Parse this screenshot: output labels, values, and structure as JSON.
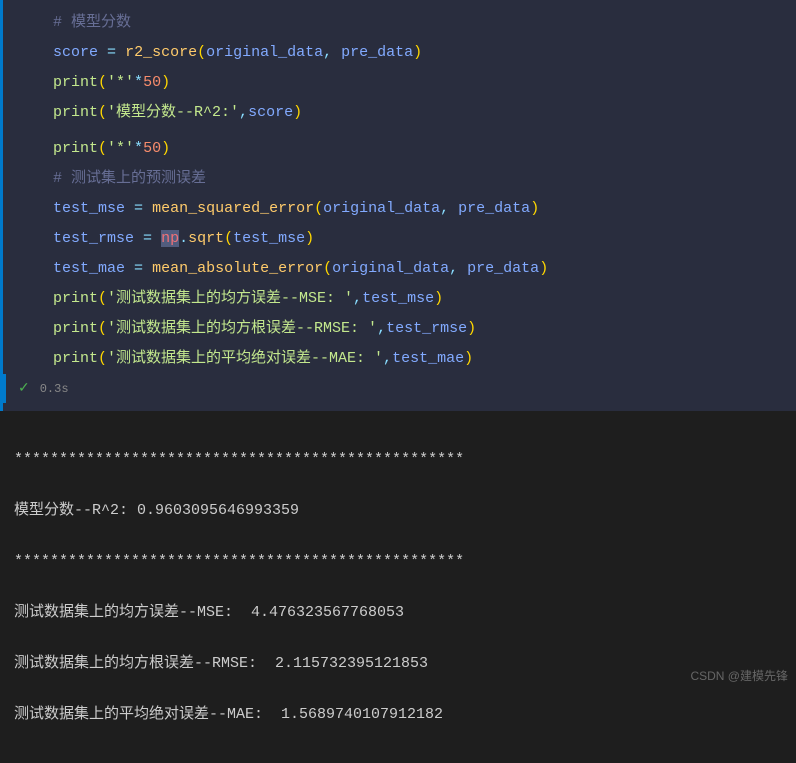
{
  "code": {
    "comment1": "# 模型分数",
    "line2_var": "score",
    "line2_func": "r2_score",
    "line2_arg1": "original_data",
    "line2_arg2": "pre_data",
    "line3_print": "print",
    "line3_str": "'*'",
    "line3_num": "50",
    "line4_print": "print",
    "line4_str": "'模型分数--R^2:'",
    "line4_arg": "score",
    "line6_print": "print",
    "line6_str": "'*'",
    "line6_num": "50",
    "comment2": "# 测试集上的预测误差",
    "line8_var": "test_mse",
    "line8_func": "mean_squared_error",
    "line8_arg1": "original_data",
    "line8_arg2": "pre_data",
    "line9_var": "test_rmse",
    "line9_mod": "np",
    "line9_func": "sqrt",
    "line9_arg": "test_mse",
    "line10_var": "test_mae",
    "line10_func": "mean_absolute_error",
    "line10_arg1": "original_data",
    "line10_arg2": "pre_data",
    "line11_print": "print",
    "line11_str": "'测试数据集上的均方误差--MSE: '",
    "line11_arg": "test_mse",
    "line12_print": "print",
    "line12_str": "'测试数据集上的均方根误差--RMSE: '",
    "line12_arg": "test_rmse",
    "line13_print": "print",
    "line13_str": "'测试数据集上的平均绝对误差--MAE: '",
    "line13_arg": "test_mae"
  },
  "status": {
    "checkmark": "✓",
    "duration": "0.3s"
  },
  "output": {
    "stars1": "**************************************************",
    "r2": "模型分数--R^2: 0.9603095646993359",
    "stars2": "**************************************************",
    "mse": "测试数据集上的均方误差--MSE:  4.476323567768053",
    "rmse": "测试数据集上的均方根误差--RMSE:  2.115732395121853",
    "mae": "测试数据集上的平均绝对误差--MAE:  1.5689740107912182"
  },
  "watermark": "CSDN @建模先锋"
}
